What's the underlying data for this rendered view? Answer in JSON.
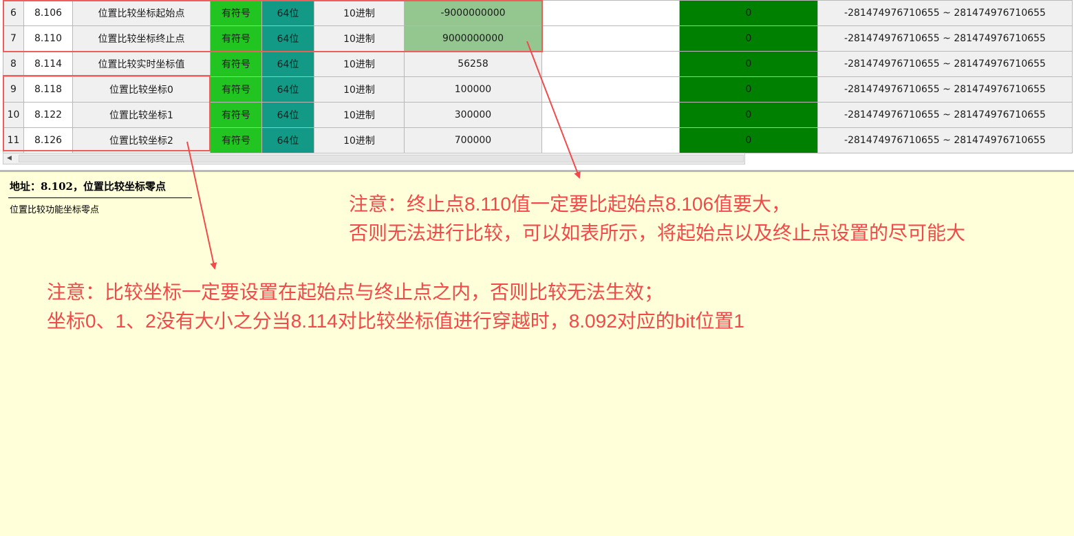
{
  "table": {
    "rows": [
      {
        "index": "6",
        "address": "8.106",
        "name": "位置比较坐标起始点",
        "sign": "有符号",
        "bits": "64位",
        "base": "10进制",
        "value": "-9000000000",
        "default": "0",
        "range": "-281474976710655 ~ 281474976710655",
        "highlighted": true
      },
      {
        "index": "7",
        "address": "8.110",
        "name": "位置比较坐标终止点",
        "sign": "有符号",
        "bits": "64位",
        "base": "10进制",
        "value": "9000000000",
        "default": "0",
        "range": "-281474976710655 ~ 281474976710655",
        "highlighted": true
      },
      {
        "index": "8",
        "address": "8.114",
        "name": "位置比较实时坐标值",
        "sign": "有符号",
        "bits": "64位",
        "base": "10进制",
        "value": "56258",
        "default": "0",
        "range": "-281474976710655 ~ 281474976710655",
        "highlighted": false
      },
      {
        "index": "9",
        "address": "8.118",
        "name": "位置比较坐标0",
        "sign": "有符号",
        "bits": "64位",
        "base": "10进制",
        "value": "100000",
        "default": "0",
        "range": "-281474976710655 ~ 281474976710655",
        "highlighted": false
      },
      {
        "index": "10",
        "address": "8.122",
        "name": "位置比较坐标1",
        "sign": "有符号",
        "bits": "64位",
        "base": "10进制",
        "value": "300000",
        "default": "0",
        "range": "-281474976710655 ~ 281474976710655",
        "highlighted": false
      },
      {
        "index": "11",
        "address": "8.126",
        "name": "位置比较坐标2",
        "sign": "有符号",
        "bits": "64位",
        "base": "10进制",
        "value": "700000",
        "default": "0",
        "range": "-281474976710655 ~ 281474976710655",
        "highlighted": false
      }
    ]
  },
  "scrollbar": {
    "left_arrow": "◀"
  },
  "description": {
    "title": "地址：8.102，位置比较坐标零点",
    "text": "位置比较功能坐标零点"
  },
  "annotations": {
    "note_a_line1": "注意：终止点8.110值一定要比起始点8.106值要大，",
    "note_a_line2": "否则无法进行比较，可以如表所示，将起始点以及终止点设置的尽可能大",
    "note_b_line1": "注意：比较坐标一定要设置在起始点与终止点之内，否则比较无法生效；",
    "note_b_line2": "坐标0、1、2没有大小之分当8.114对比较坐标值进行穿越时，8.092对应的bit位置1"
  },
  "colors": {
    "annotation_red": "#f04a4a",
    "sign_green": "#22c422",
    "bits_teal": "#129a86",
    "value_highlight": "#94c690",
    "default_green": "#008000",
    "panel_yellow": "#ffffd9"
  }
}
